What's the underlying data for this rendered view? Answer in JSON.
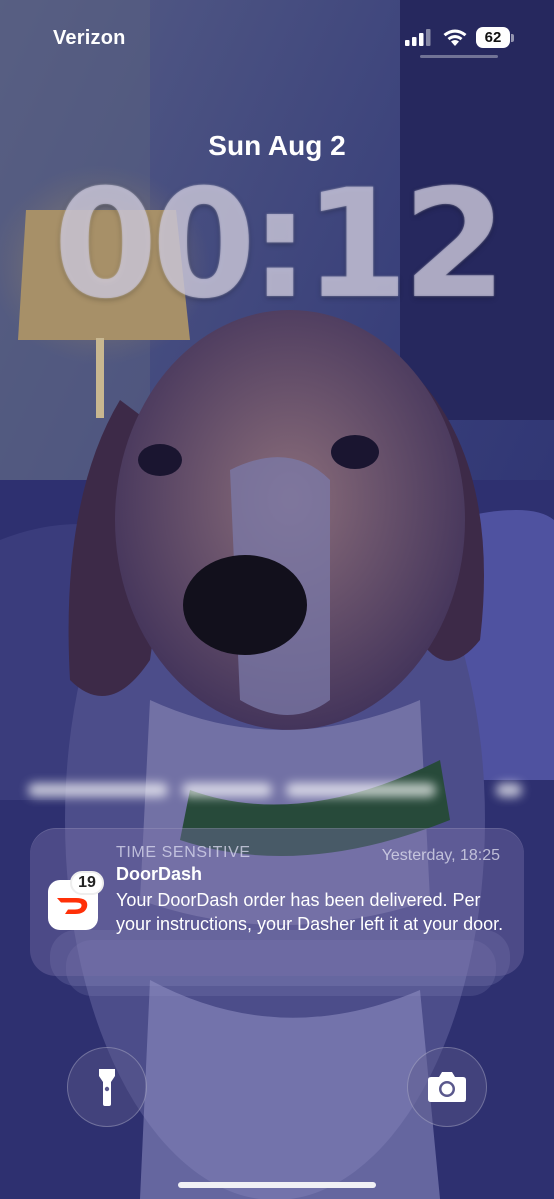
{
  "status_bar": {
    "carrier": "Verizon",
    "battery": "62",
    "signal_icon": "cellular-signal-icon",
    "wifi_icon": "wifi-icon",
    "battery_icon": "battery-icon"
  },
  "lock_screen": {
    "date": "Sun Aug 2",
    "time": "00:12"
  },
  "notification": {
    "label": "TIME SENSITIVE",
    "timestamp": "Yesterday, 18:25",
    "app_name": "DoorDash",
    "body": "Your DoorDash order has been delivered. Per your instructions, your Dasher left it at your door.",
    "badge_count": "19",
    "icon": "doordash-icon",
    "accent_color": "#ff3008"
  },
  "controls": {
    "flashlight_icon": "flashlight-icon",
    "camera_icon": "camera-icon"
  }
}
